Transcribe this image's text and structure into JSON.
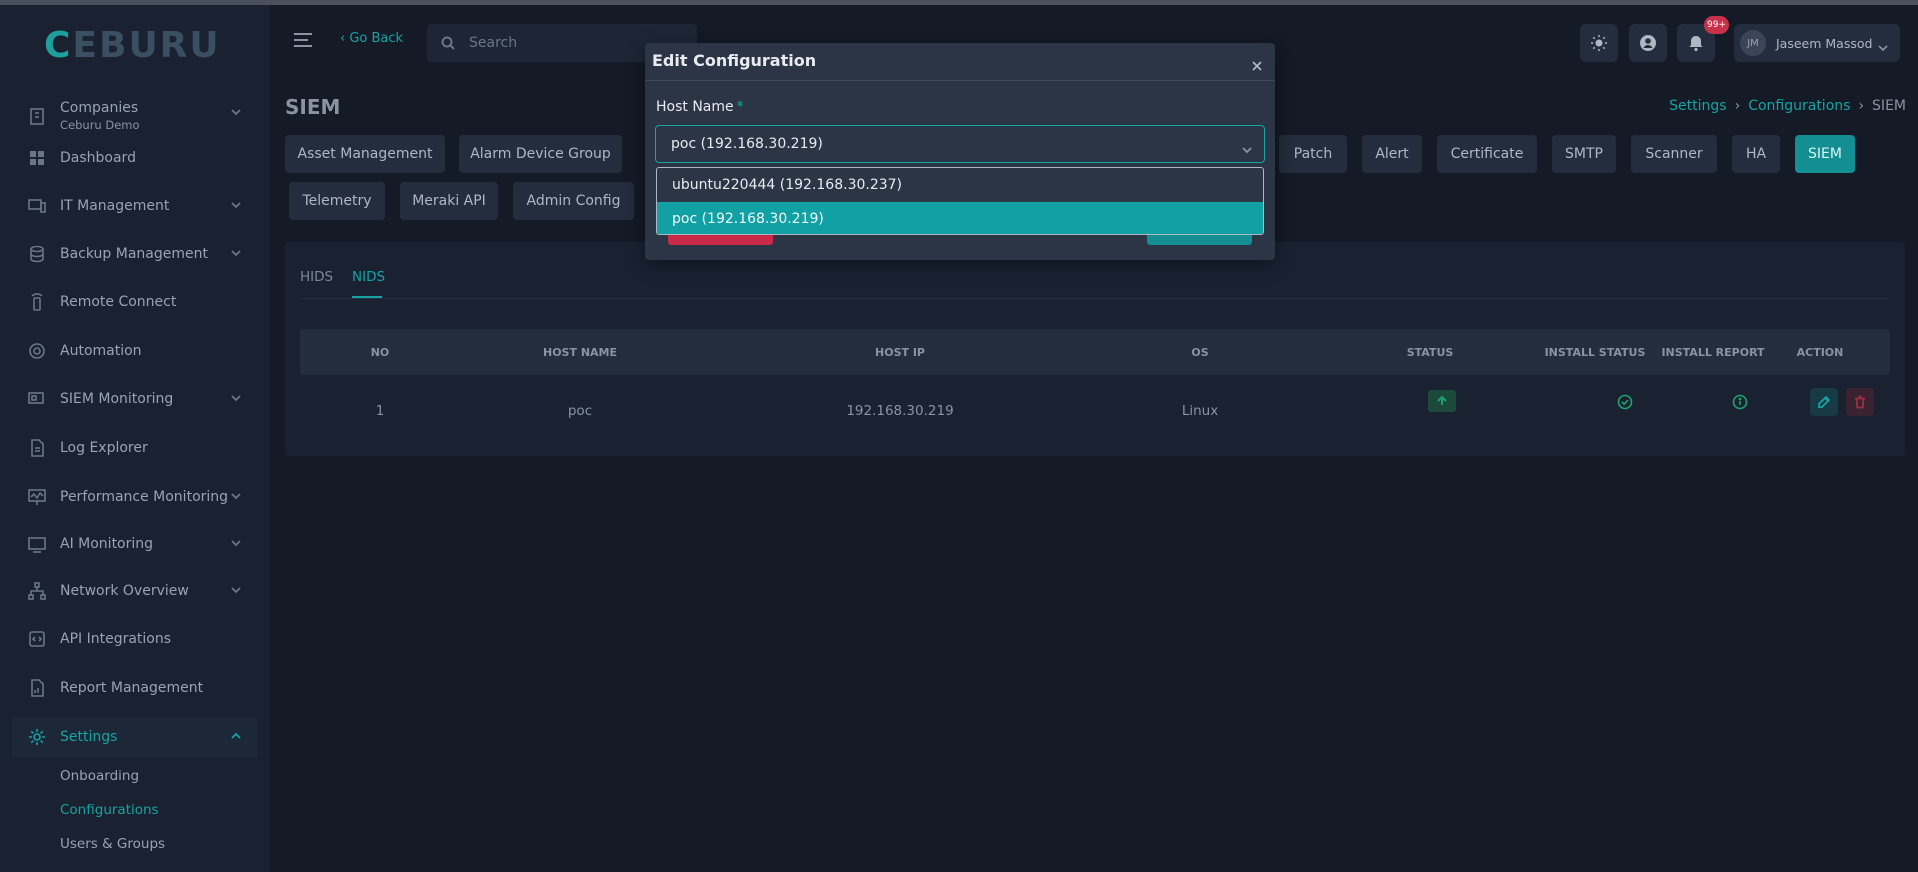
{
  "app": {
    "logo_text": "CEBURU"
  },
  "sidebar": {
    "items": [
      {
        "label": "Companies",
        "sub": "Ceburu Demo",
        "icon": "building-icon",
        "chevron": true
      },
      {
        "label": "Dashboard",
        "icon": "grid-icon",
        "chevron": false
      },
      {
        "label": "IT Management",
        "icon": "devices-icon",
        "chevron": true
      },
      {
        "label": "Backup Management",
        "icon": "database-icon",
        "chevron": true
      },
      {
        "label": "Remote Connect",
        "icon": "remote-icon",
        "chevron": false
      },
      {
        "label": "Automation",
        "icon": "gear-cycle-icon",
        "chevron": false
      },
      {
        "label": "SIEM Monitoring",
        "icon": "monitor-icon",
        "chevron": true
      },
      {
        "label": "Log Explorer",
        "icon": "document-icon",
        "chevron": false
      },
      {
        "label": "Performance Monitoring",
        "icon": "performance-icon",
        "chevron": true
      },
      {
        "label": "AI Monitoring",
        "icon": "ai-icon",
        "chevron": true
      },
      {
        "label": "Network Overview",
        "icon": "network-icon",
        "chevron": true
      },
      {
        "label": "API Integrations",
        "icon": "code-icon",
        "chevron": false
      },
      {
        "label": "Report Management",
        "icon": "report-icon",
        "chevron": false
      },
      {
        "label": "Settings",
        "icon": "settings-icon",
        "chevron": true
      }
    ],
    "settings_sub": [
      "Onboarding",
      "Configurations",
      "Users & Groups"
    ]
  },
  "header": {
    "go_back": "‹ Go Back",
    "search_placeholder": "Search",
    "notification_badge": "99+",
    "user_initials": "JM",
    "user_name": "Jaseem Massod"
  },
  "page": {
    "title": "SIEM",
    "breadcrumb": [
      "Settings",
      "Configurations",
      "SIEM"
    ]
  },
  "config_tabs": [
    "Asset Management",
    "Alarm Device Group",
    "Patch",
    "Alert",
    "Certificate",
    "SMTP",
    "Scanner",
    "HA",
    "SIEM",
    "Telemetry",
    "Meraki API",
    "Admin Config"
  ],
  "active_config_tab": "SIEM",
  "panel": {
    "subtabs": [
      "HIDS",
      "NIDS"
    ],
    "active_subtab": "NIDS",
    "columns": [
      "NO",
      "HOST NAME",
      "HOST IP",
      "OS",
      "STATUS",
      "INSTALL STATUS",
      "INSTALL REPORT",
      "ACTION"
    ],
    "rows": [
      {
        "no": "1",
        "host_name": "poc",
        "host_ip": "192.168.30.219",
        "os": "Linux"
      }
    ]
  },
  "modal": {
    "title": "Edit Configuration",
    "field_label": "Host Name",
    "required_mark": "*",
    "selected_value": "poc (192.168.30.219)",
    "options": [
      "ubuntu220444 (192.168.30.237)",
      "poc (192.168.30.219)"
    ],
    "highlighted_option": "poc (192.168.30.219)"
  },
  "colors": {
    "accent": "#16a3a3",
    "danger": "#c92a48",
    "background": "#141a26"
  }
}
